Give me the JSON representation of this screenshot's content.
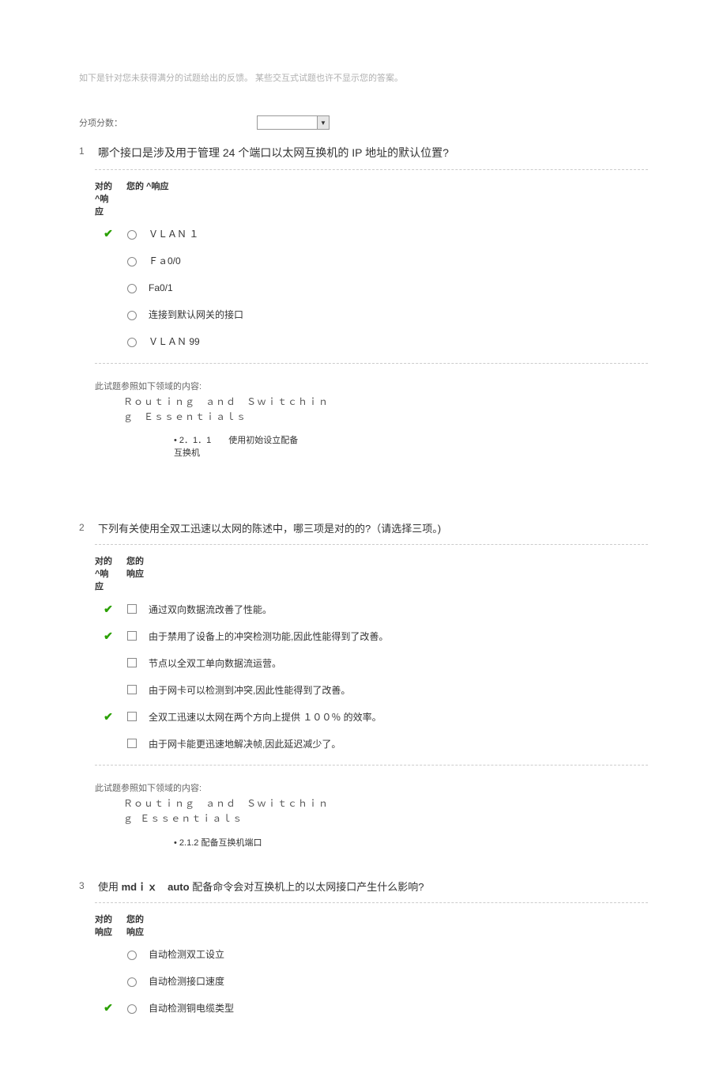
{
  "intro": "如下是针对您未获得满分的试题给出的反馈。  某些交互式试题也许不显示您的答案。",
  "score_label": "分项分数：",
  "col_headers": {
    "correct_a": "对的",
    "correct_b": "^响",
    "correct_c": "应",
    "correct2_b": "响应",
    "resp_a": "您的 ^响应",
    "resp_b": "您的",
    "resp_c": "响应"
  },
  "q1": {
    "num": "1",
    "text_a": "哪个接口是涉及用于管理 24 个端口以太网互换机的 ",
    "text_b": "IP",
    "text_c": " 地址的默认位置?",
    "options": [
      {
        "correct": true,
        "label": "ＶＬＡＮ １"
      },
      {
        "correct": false,
        "label": "Ｆａ0/0"
      },
      {
        "correct": false,
        "label": "Fa0/1"
      },
      {
        "correct": false,
        "label": "连接到默认网关的接口"
      },
      {
        "correct": false,
        "label": "ＶＬＡＮ 99"
      }
    ],
    "domain_title": "此试题参照如下领域的内容:",
    "domain_sub": "Ｒｏｕｔｉｎｇ　ａｎｄ　Ｓｗｉｔｃｈｉｎｇ　Ｅｓｓｅｎｔｉａｌｓ",
    "domain_bullet": "2．1．1　　使用初始设立配备互换机"
  },
  "q2": {
    "num": "2",
    "text": "下列有关使用全双工迅速以太网的陈述中，哪三项是对的的?（请选择三项。)",
    "options": [
      {
        "correct": true,
        "label": "通过双向数据流改善了性能。"
      },
      {
        "correct": true,
        "label": "由于禁用了设备上的冲突检测功能,因此性能得到了改善。"
      },
      {
        "correct": false,
        "label": "节点以全双工单向数据流运营。"
      },
      {
        "correct": false,
        "label": "由于网卡可以检测到冲突,因此性能得到了改善。"
      },
      {
        "correct": true,
        "label": "全双工迅速以太网在两个方向上提供 １００％ 的效率。"
      },
      {
        "correct": false,
        "label": "由于网卡能更迅速地解决帧,因此延迟减少了。"
      }
    ],
    "domain_title": "此试题参照如下领域的内容:",
    "domain_sub": "Ｒｏｕｔｉｎｇ　ａｎｄ　Ｓｗｉｔｃｈｉｎｇ Ｅｓｓｅｎｔｉａｌｓ",
    "domain_bullet": "2.1.2 配备互换机端口"
  },
  "q3": {
    "num": "3",
    "text_a": "使用 ",
    "text_b": "mdｉｘ　auto",
    "text_c": " 配备命令会对互换机上的以太网接口产生什么影响?",
    "options": [
      {
        "correct": false,
        "label": "自动检测双工设立"
      },
      {
        "correct": false,
        "label": "自动检测接口速度"
      },
      {
        "correct": true,
        "label": "自动检测铜电缆类型"
      }
    ]
  }
}
